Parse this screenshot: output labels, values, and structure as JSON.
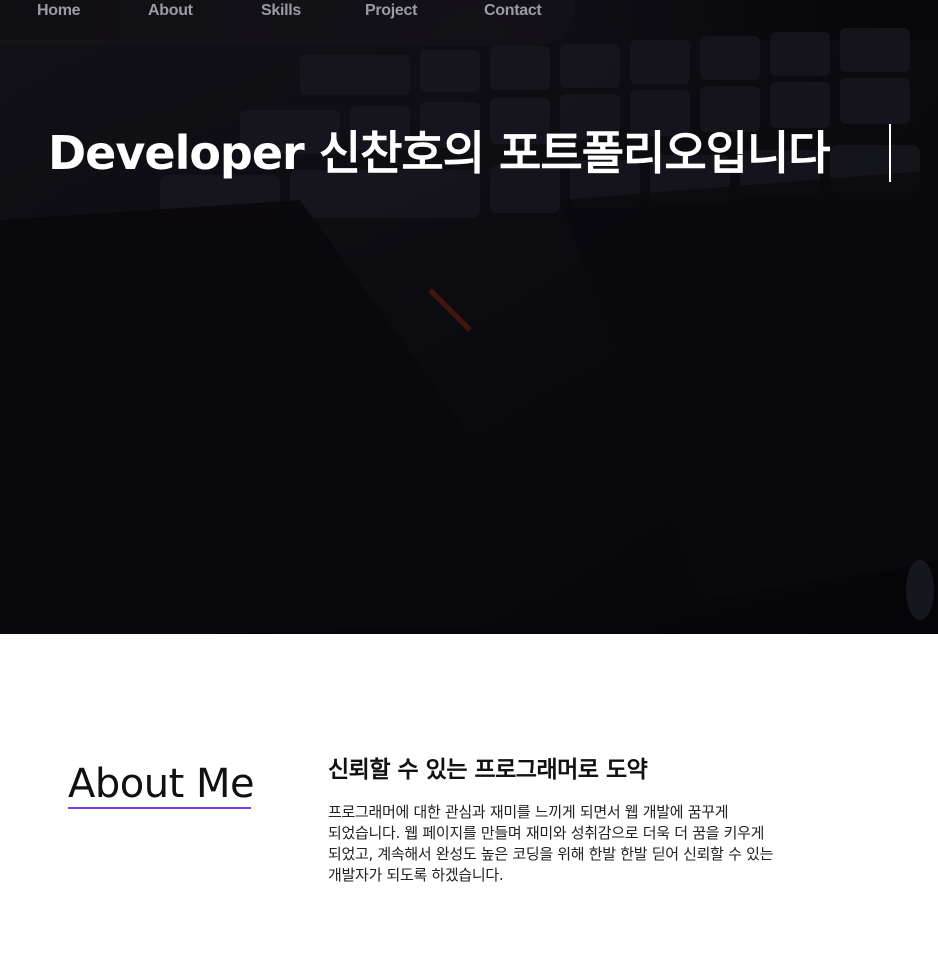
{
  "nav": {
    "items": [
      {
        "label": "Home"
      },
      {
        "label": "About"
      },
      {
        "label": "Skills"
      },
      {
        "label": "Project"
      },
      {
        "label": "Contact"
      }
    ]
  },
  "hero": {
    "title": "Developer 신찬호의 포트폴리오입니다",
    "background": "dark-keyboard-photo"
  },
  "about": {
    "heading": "About Me",
    "subtitle": "신뢰할 수 있는 프로그래머로 도약",
    "body": "프로그래머에 대한 관심과 재미를 느끼게 되면서 웹 개발에 꿈꾸게 되었습니다. 웹 페이지를 만들며 재미와 성취감으로 더욱 더 꿈을 키우게 되었고, 계속해서 완성도 높은 코딩을 위해 한발 한발 딛어 신뢰할 수 있는 개발자가 되도록 하겠습니다.",
    "accent_color": "#7a3de0"
  }
}
